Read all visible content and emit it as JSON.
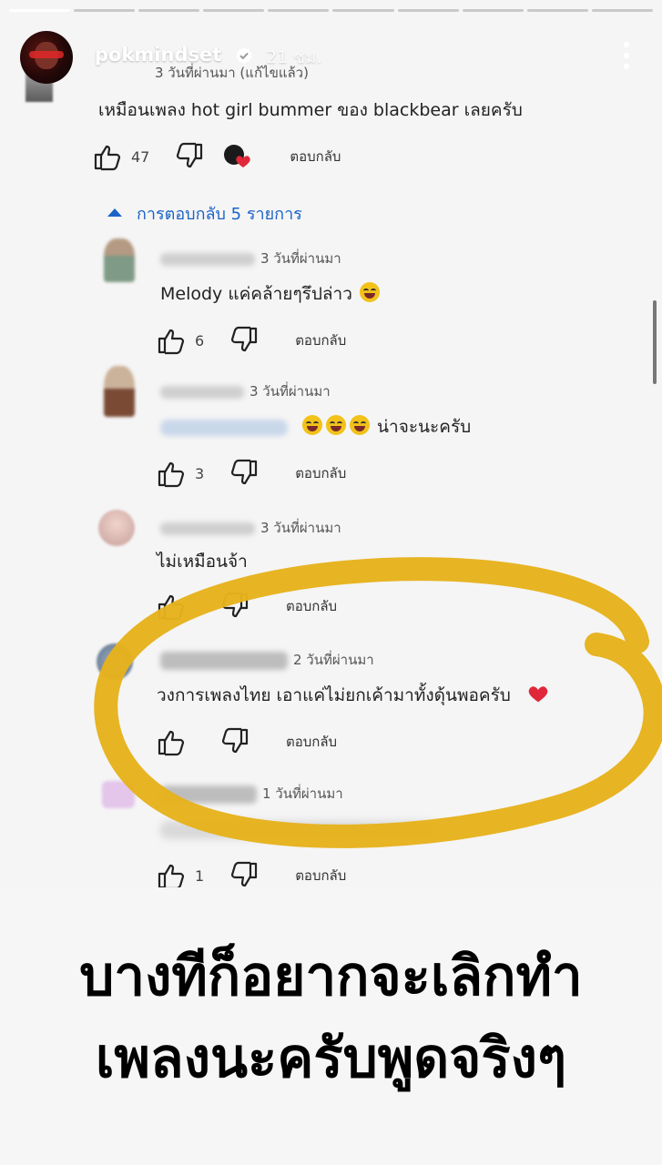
{
  "story": {
    "username": "pokmindset",
    "time_ago": "21 ชม."
  },
  "top_comment": {
    "meta": "3 วันที่ผ่านมา (แก้ไขแล้ว)",
    "text": "เหมือนเพลง hot girl bummer ของ blackbear เลยครับ",
    "likes": "47",
    "reply_label": "ตอบกลับ"
  },
  "replies_toggle": "การตอบกลับ 5 รายการ",
  "replies": [
    {
      "meta": "3 วันที่ผ่านมา",
      "text": "Melody แค่คล้ายๆรึปล่าว",
      "likes": "6",
      "reply_label": "ตอบกลับ"
    },
    {
      "meta": "3 วันที่ผ่านมา",
      "text": "น่าจะนะครับ",
      "likes": "3",
      "reply_label": "ตอบกลับ"
    },
    {
      "meta": "3 วันที่ผ่านมา",
      "text": "ไม่เหมือนจ้า",
      "likes": "",
      "reply_label": "ตอบกลับ"
    },
    {
      "meta": "2 วันที่ผ่านมา",
      "text": "วงการเพลงไทย เอาแค่ไม่ยกเค้ามาทั้งดุ้นพอครับ",
      "likes": "",
      "reply_label": "ตอบกลับ"
    },
    {
      "meta": "1 วันที่ผ่านมา",
      "text": "",
      "likes": "1",
      "reply_label": "ตอบกลับ"
    }
  ],
  "caption": {
    "line1": "บางทีก็อยากจะเลิกทำ",
    "line2": "เพลงนะครับพูดจริงๆ"
  },
  "colors": {
    "link_blue": "#1a63c8",
    "circle_yellow": "#e6b21c",
    "heart_red": "#e0283a"
  }
}
